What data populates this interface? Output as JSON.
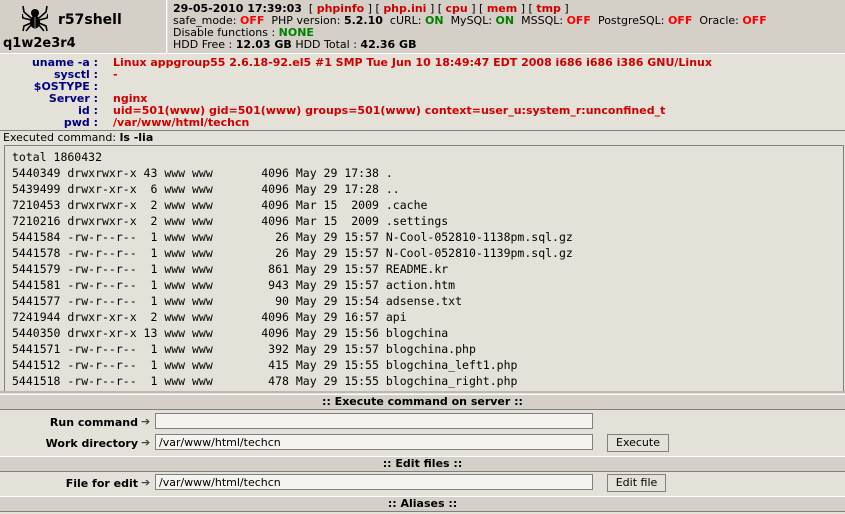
{
  "header": {
    "logo_text": "r57shell",
    "hostname": "q1w2e3r4",
    "datetime": "29-05-2010 17:39:03",
    "links": [
      "phpinfo",
      "php.ini",
      "cpu",
      "mem",
      "tmp"
    ],
    "safe_mode_label": "safe_mode:",
    "safe_mode_value": "OFF",
    "php_version_label": "PHP version:",
    "php_version_value": "5.2.10",
    "curl_label": "cURL:",
    "curl_value": "ON",
    "mysql_label": "MySQL:",
    "mysql_value": "ON",
    "mssql_label": "MSSQL:",
    "mssql_value": "OFF",
    "postgresql_label": "PostgreSQL:",
    "postgresql_value": "OFF",
    "oracle_label": "Oracle:",
    "oracle_value": "OFF",
    "disable_functions_label": "Disable functions :",
    "disable_functions_value": "NONE",
    "hdd_free_label": "HDD Free :",
    "hdd_free_value": "12.03 GB",
    "hdd_total_label": "HDD Total :",
    "hdd_total_value": "42.36 GB"
  },
  "sysinfo": [
    {
      "label": "uname -a :",
      "value": "Linux appgroup55 2.6.18-92.el5 #1 SMP Tue Jun 10 18:49:47 EDT 2008 i686 i686 i386 GNU/Linux"
    },
    {
      "label": "sysctl :",
      "value": "-"
    },
    {
      "label": "$OSTYPE :",
      "value": ""
    },
    {
      "label": "Server :",
      "value": "nginx"
    },
    {
      "label": "id :",
      "value": "uid=501(www) gid=501(www) groups=501(www) context=user_u:system_r:unconfined_t"
    },
    {
      "label": "pwd :",
      "value": "/var/www/html/techcn"
    }
  ],
  "executed": {
    "label": "Executed command:",
    "command": "ls -lia"
  },
  "terminal_lines": [
    "total 1860432",
    "5440349 drwxrwxr-x 43 www www       4096 May 29 17:38 .",
    "5439499 drwxr-xr-x  6 www www       4096 May 29 17:28 ..",
    "7210453 drwxrwxr-x  2 www www       4096 Mar 15  2009 .cache",
    "7210216 drwxrwxr-x  2 www www       4096 Mar 15  2009 .settings",
    "5441584 -rw-r--r--  1 www www         26 May 29 15:57 N-Cool-052810-1138pm.sql.gz",
    "5441578 -rw-r--r--  1 www www         26 May 29 15:57 N-Cool-052810-1139pm.sql.gz",
    "5441579 -rw-r--r--  1 www www        861 May 29 15:57 README.kr",
    "5441581 -rw-r--r--  1 www www        943 May 29 15:57 action.htm",
    "5441577 -rw-r--r--  1 www www         90 May 29 15:54 adsense.txt",
    "7241944 drwxr-xr-x  2 www www       4096 May 29 16:57 api",
    "5440350 drwxr-xr-x 13 www www       4096 May 29 15:56 blogchina",
    "5441571 -rw-r--r--  1 www www        392 May 29 15:57 blogchina.php",
    "5441512 -rw-r--r--  1 www www        415 May 29 15:55 blogchina_left1.php",
    "5441518 -rw-r--r--  1 www www        478 May 29 15:55 blogchina_right.php"
  ],
  "execute_section": {
    "title": ":: Execute command on server ::",
    "run_label": "Run command",
    "run_value": "",
    "workdir_label": "Work directory",
    "workdir_value": "/var/www/html/techcn",
    "button": "Execute"
  },
  "edit_section": {
    "title": ":: Edit files ::",
    "file_label": "File for edit",
    "file_value": "/var/www/html/techcn",
    "button": "Edit file"
  },
  "aliases_section": {
    "title": ":: Aliases ::"
  }
}
